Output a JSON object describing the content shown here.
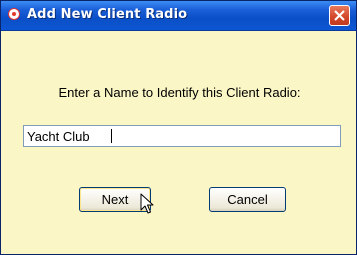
{
  "window": {
    "title": "Add New Client Radio",
    "icon": "app-radio-icon",
    "close_icon": "close-icon"
  },
  "dialog": {
    "prompt": "Enter a Name to Identify this Client Radio:",
    "name_value": "Yacht Club",
    "next_label": "Next",
    "cancel_label": "Cancel"
  },
  "colors": {
    "background": "#fbf6c6",
    "titlebar": "#0a4fc7",
    "close_button": "#d2462a"
  }
}
